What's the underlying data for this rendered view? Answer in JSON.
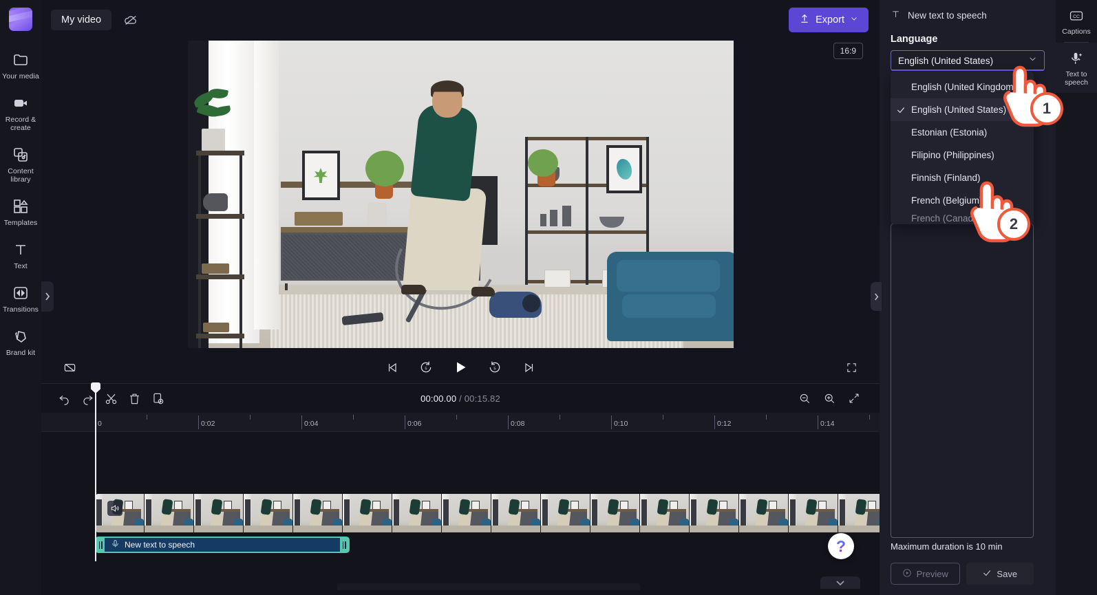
{
  "app": {
    "project_name": "My video",
    "export_label": "Export",
    "ratio_badge": "16:9"
  },
  "left_rail": {
    "logo_name": "clipchamp-logo",
    "items": [
      {
        "label": "Your media",
        "icon": "folder-icon",
        "name": "sidebar-item-your-media"
      },
      {
        "label": "Record & create",
        "icon": "video-camera-icon",
        "name": "sidebar-item-record-create"
      },
      {
        "label": "Content library",
        "icon": "content-library-icon",
        "name": "sidebar-item-content-library"
      },
      {
        "label": "Templates",
        "icon": "templates-icon",
        "name": "sidebar-item-templates"
      },
      {
        "label": "Text",
        "icon": "text-icon",
        "name": "sidebar-item-text"
      },
      {
        "label": "Transitions",
        "icon": "transitions-icon",
        "name": "sidebar-item-transitions"
      },
      {
        "label": "Brand kit",
        "icon": "brand-kit-icon",
        "name": "sidebar-item-brand-kit"
      }
    ]
  },
  "player": {
    "captions_toggle_icon": "captions-off-icon",
    "skip_start_icon": "skip-to-start-icon",
    "back5_label": "5",
    "play_icon": "play-icon",
    "fwd5_label": "5",
    "skip_end_icon": "skip-to-end-icon",
    "fullscreen_icon": "fullscreen-icon",
    "help_icon": "question-mark-icon"
  },
  "timeline": {
    "current_time": "00:00.00",
    "separator": " / ",
    "total_time": "00:15.82",
    "tools": [
      {
        "label": "Undo",
        "icon": "undo-icon",
        "name": "undo-button"
      },
      {
        "label": "Redo",
        "icon": "redo-icon",
        "name": "redo-button"
      },
      {
        "label": "Split",
        "icon": "scissors-icon",
        "name": "split-button"
      },
      {
        "label": "Delete",
        "icon": "trash-icon",
        "name": "delete-button"
      },
      {
        "label": "Duplicate",
        "icon": "duplicate-icon",
        "name": "duplicate-button"
      }
    ],
    "zoom_out_icon": "zoom-out-icon",
    "zoom_in_icon": "zoom-in-icon",
    "fit_icon": "fit-to-timeline-icon",
    "ruler_labels": [
      "0",
      "0:02",
      "0:04",
      "0:06",
      "0:08",
      "0:10",
      "0:12",
      "0:14"
    ],
    "video_track": {
      "name": "video-clip",
      "mute_icon": "speaker-icon"
    },
    "tts_track": {
      "label": "New text to speech",
      "icon": "text-to-speech-icon"
    }
  },
  "right_panel": {
    "header_title": "New text to speech",
    "header_icon": "text-icon",
    "language_label": "Language",
    "selected_language": "English (United States)",
    "dropdown_open": true,
    "dropdown_options": [
      {
        "label": "English (United Kingdom)",
        "checked": false
      },
      {
        "label": "English (United States)",
        "checked": true
      },
      {
        "label": "Estonian (Estonia)",
        "checked": false
      },
      {
        "label": "Filipino (Philippines)",
        "checked": false
      },
      {
        "label": "Finnish (Finland)",
        "checked": false
      },
      {
        "label": "French (Belgium)",
        "checked": false
      },
      {
        "label": "French (Canada)",
        "checked": false
      }
    ],
    "textarea_value": "",
    "textarea_placeholder": "",
    "max_duration_note": "Maximum duration is 10 min",
    "preview_label": "Preview",
    "save_label": "Save"
  },
  "far_rail": {
    "items": [
      {
        "label": "Captions",
        "icon": "cc-icon",
        "name": "tab-captions",
        "active": false
      },
      {
        "label": "Text to speech",
        "icon": "microphone-sparkle-icon",
        "name": "tab-text-to-speech",
        "active": true
      }
    ]
  },
  "callouts": [
    {
      "number": "1",
      "target": "language-select-dropdown"
    },
    {
      "number": "2",
      "target": "dropdown-option-french-belgium"
    }
  ],
  "colors": {
    "accent": "#5b46d6",
    "panel_bg": "#1d1d2a",
    "app_bg": "#14141f",
    "callout_orange": "#f05a3c",
    "tts_clip": "#153a63",
    "tts_border": "#57c8b0"
  }
}
